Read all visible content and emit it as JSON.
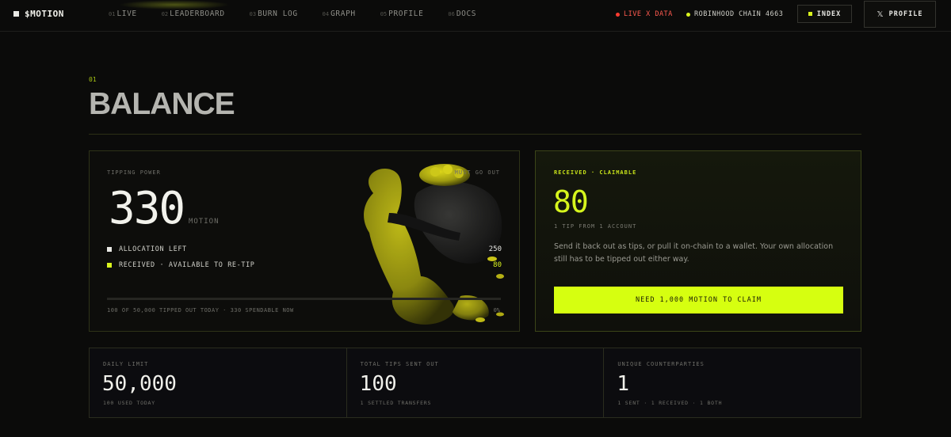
{
  "nav": {
    "brand": "$MOTION",
    "links": [
      {
        "num": "01",
        "label": "LIVE"
      },
      {
        "num": "02",
        "label": "LEADERBOARD"
      },
      {
        "num": "03",
        "label": "BURN LOG"
      },
      {
        "num": "04",
        "label": "GRAPH"
      },
      {
        "num": "05",
        "label": "PROFILE"
      },
      {
        "num": "06",
        "label": "DOCS"
      }
    ],
    "live_label": "LIVE X DATA",
    "chain_label": "ROBINHOOD CHAIN 4663",
    "index_button": "INDEX",
    "profile_button": "PROFILE",
    "colors": {
      "live_dot": "#ff3b30",
      "chain_dot": "#d9f41e",
      "accent": "#d6ff10"
    }
  },
  "section": {
    "number": "01",
    "title": "BALANCE"
  },
  "tipping": {
    "label": "TIPPING POWER",
    "must_go_out": "MUST GO OUT",
    "value": "330",
    "unit": "MOTION",
    "rows": [
      {
        "label": "ALLOCATION LEFT",
        "value": "250",
        "color": "#e8e8e4"
      },
      {
        "label": "RECEIVED · AVAILABLE TO RE-TIP",
        "value": "80",
        "color": "#d9f41e"
      }
    ],
    "progress_fraction": 0.0,
    "progress_caption": "100 OF 50,000 TIPPED OUT TODAY · 330 SPENDABLE NOW",
    "progress_pct": "0%"
  },
  "claim": {
    "label": "RECEIVED · CLAIMABLE",
    "value": "80",
    "sub": "1 TIP FROM 1 ACCOUNT",
    "description": "Send it back out as tips, or pull it on-chain to a wallet. Your own allocation still has to be tipped out either way.",
    "button": "NEED 1,000 MOTION TO CLAIM"
  },
  "stats": [
    {
      "label": "DAILY LIMIT",
      "value": "50,000",
      "sub": "100 USED TODAY"
    },
    {
      "label": "TOTAL TIPS SENT OUT",
      "value": "100",
      "sub": "1 SETTLED TRANSFERS"
    },
    {
      "label": "UNIQUE COUNTERPARTIES",
      "value": "1",
      "sub": "1 SENT · 1 RECEIVED · 1 BOTH"
    }
  ]
}
